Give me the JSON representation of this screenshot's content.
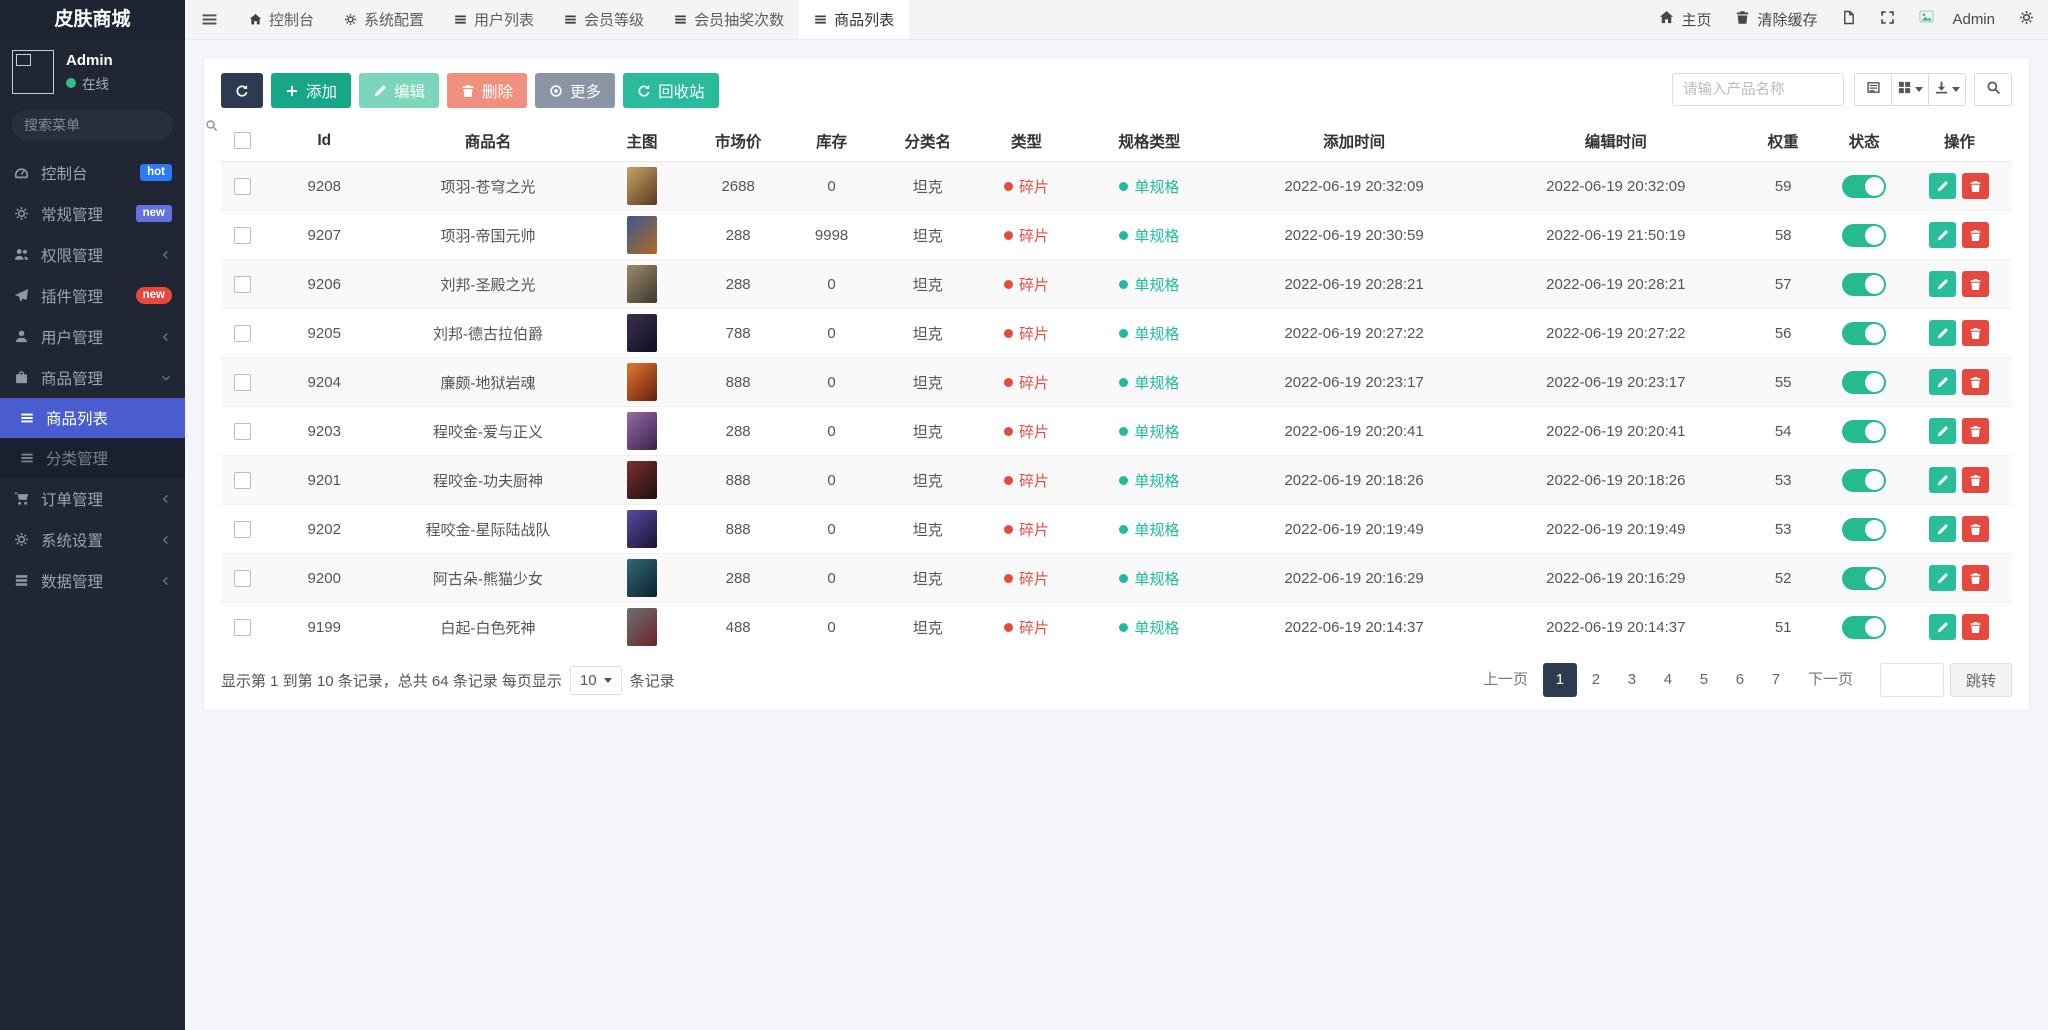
{
  "colors": {
    "sidebar_active": "#4a5dd0",
    "online": "#2fbe8f",
    "type_red": "#e8493e",
    "spec_green": "#1fbc9c",
    "toggle_on": "#25ba90",
    "edit_green": "#2abd9a",
    "delete_red": "#e5493d",
    "page_active": "#2e3a4d"
  },
  "brand": {
    "title": "皮肤商城"
  },
  "user_panel": {
    "name": "Admin",
    "status_label": "在线"
  },
  "sidebar": {
    "search_placeholder": "搜索菜单",
    "menu": [
      {
        "label": "控制台",
        "icon": "dashboard-icon",
        "badge": "hot",
        "badge_color": "#2d7bf4"
      },
      {
        "label": "常规管理",
        "icon": "gear-icon",
        "badge": "new",
        "badge_color": "#6372e0"
      },
      {
        "label": "权限管理",
        "icon": "users-icon",
        "chevron": "left"
      },
      {
        "label": "插件管理",
        "icon": "send-icon",
        "badge": "new",
        "badge_color": "#e8473c",
        "badge_pill": true
      },
      {
        "label": "用户管理",
        "icon": "user-icon",
        "chevron": "left"
      },
      {
        "label": "商品管理",
        "icon": "bag-icon",
        "chevron": "down",
        "expanded": true,
        "children": [
          {
            "label": "商品列表",
            "icon": "list-icon",
            "active": true
          },
          {
            "label": "分类管理",
            "icon": "list-icon"
          }
        ]
      },
      {
        "label": "订单管理",
        "icon": "cart-icon",
        "chevron": "left"
      },
      {
        "label": "系统设置",
        "icon": "gear-icon",
        "chevron": "left"
      },
      {
        "label": "数据管理",
        "icon": "database-icon",
        "chevron": "left"
      }
    ]
  },
  "navbar": {
    "tabs": [
      {
        "label": "控制台",
        "icon": "home-icon"
      },
      {
        "label": "系统配置",
        "icon": "gear-icon"
      },
      {
        "label": "用户列表",
        "icon": "list-icon"
      },
      {
        "label": "会员等级",
        "icon": "list-icon"
      },
      {
        "label": "会员抽奖次数",
        "icon": "list-icon"
      },
      {
        "label": "商品列表",
        "icon": "list-icon",
        "active": true
      }
    ],
    "right": {
      "home_label": "主页",
      "clear_cache_label": "清除缓存",
      "username": "Admin"
    }
  },
  "toolbar": {
    "buttons": [
      {
        "name": "refresh-button",
        "icon": "refresh-icon",
        "label": "",
        "color": "#2e3a4f"
      },
      {
        "name": "add-button",
        "icon": "plus-icon",
        "label": "添加",
        "color": "#18a689"
      },
      {
        "name": "edit-button",
        "icon": "pencil-icon",
        "label": "编辑",
        "color": "#7bd6bb",
        "disabled": true
      },
      {
        "name": "delete-button",
        "icon": "trash-icon",
        "label": "删除",
        "color": "#f0917f",
        "disabled": true
      },
      {
        "name": "more-button",
        "icon": "circle-dot-icon",
        "label": "更多",
        "color": "#8b95a5"
      },
      {
        "name": "recycle-bin-button",
        "icon": "recycle-icon",
        "label": "回收站",
        "color": "#29bb9c"
      }
    ],
    "search_placeholder": "请输入产品名称"
  },
  "table": {
    "columns": [
      "Id",
      "商品名",
      "主图",
      "市场价",
      "库存",
      "分类名",
      "类型",
      "规格类型",
      "添加时间",
      "编辑时间",
      "权重",
      "状态",
      "操作"
    ],
    "rows": [
      {
        "id": "9208",
        "name": "项羽-苍穹之光",
        "price": "2688",
        "stock": "0",
        "category": "坦克",
        "type": "碎片",
        "spec": "单规格",
        "created": "2022-06-19 20:32:09",
        "updated": "2022-06-19 20:32:09",
        "weight": "59",
        "status": true,
        "thumb": [
          "#c9a36a",
          "#59381e"
        ]
      },
      {
        "id": "9207",
        "name": "项羽-帝国元帅",
        "price": "288",
        "stock": "9998",
        "category": "坦克",
        "type": "碎片",
        "spec": "单规格",
        "created": "2022-06-19 20:30:59",
        "updated": "2022-06-19 21:50:19",
        "weight": "58",
        "status": true,
        "thumb": [
          "#3a5a8c",
          "#b06a28"
        ]
      },
      {
        "id": "9206",
        "name": "刘邦-圣殿之光",
        "price": "288",
        "stock": "0",
        "category": "坦克",
        "type": "碎片",
        "spec": "单规格",
        "created": "2022-06-19 20:28:21",
        "updated": "2022-06-19 20:28:21",
        "weight": "57",
        "status": true,
        "thumb": [
          "#9a8a68",
          "#3f3a30"
        ]
      },
      {
        "id": "9205",
        "name": "刘邦-德古拉伯爵",
        "price": "788",
        "stock": "0",
        "category": "坦克",
        "type": "碎片",
        "spec": "单规格",
        "created": "2022-06-19 20:27:22",
        "updated": "2022-06-19 20:27:22",
        "weight": "56",
        "status": true,
        "thumb": [
          "#3a3050",
          "#120e20"
        ]
      },
      {
        "id": "9204",
        "name": "廉颇-地狱岩魂",
        "price": "888",
        "stock": "0",
        "category": "坦克",
        "type": "碎片",
        "spec": "单规格",
        "created": "2022-06-19 20:23:17",
        "updated": "2022-06-19 20:23:17",
        "weight": "55",
        "status": true,
        "thumb": [
          "#e07830",
          "#66200e"
        ]
      },
      {
        "id": "9203",
        "name": "程咬金-爱与正义",
        "price": "288",
        "stock": "0",
        "category": "坦克",
        "type": "碎片",
        "spec": "单规格",
        "created": "2022-06-19 20:20:41",
        "updated": "2022-06-19 20:20:41",
        "weight": "54",
        "status": true,
        "thumb": [
          "#9a6aa8",
          "#35244e"
        ]
      },
      {
        "id": "9201",
        "name": "程咬金-功夫厨神",
        "price": "888",
        "stock": "0",
        "category": "坦克",
        "type": "碎片",
        "spec": "单规格",
        "created": "2022-06-19 20:18:26",
        "updated": "2022-06-19 20:18:26",
        "weight": "53",
        "status": true,
        "thumb": [
          "#7a3030",
          "#1e1010"
        ]
      },
      {
        "id": "9202",
        "name": "程咬金-星际陆战队",
        "price": "888",
        "stock": "0",
        "category": "坦克",
        "type": "碎片",
        "spec": "单规格",
        "created": "2022-06-19 20:19:49",
        "updated": "2022-06-19 20:19:49",
        "weight": "53",
        "status": true,
        "thumb": [
          "#5a4aa0",
          "#191432"
        ]
      },
      {
        "id": "9200",
        "name": "阿古朵-熊猫少女",
        "price": "288",
        "stock": "0",
        "category": "坦克",
        "type": "碎片",
        "spec": "单规格",
        "created": "2022-06-19 20:16:29",
        "updated": "2022-06-19 20:16:29",
        "weight": "52",
        "status": true,
        "thumb": [
          "#2e6a78",
          "#14202e"
        ]
      },
      {
        "id": "9199",
        "name": "白起-白色死神",
        "price": "488",
        "stock": "0",
        "category": "坦克",
        "type": "碎片",
        "spec": "单规格",
        "created": "2022-06-19 20:14:37",
        "updated": "2022-06-19 20:14:37",
        "weight": "51",
        "status": true,
        "thumb": [
          "#6a7078",
          "#6e2626"
        ]
      }
    ]
  },
  "table_footer": {
    "summary_prefix": "显示第 1 到第 10 条记录，总共 64 条记录 每页显示",
    "page_size": "10",
    "summary_suffix": "条记录",
    "pagination": {
      "prev_label": "上一页",
      "pages": [
        "1",
        "2",
        "3",
        "4",
        "5",
        "6",
        "7"
      ],
      "active_page": "1",
      "next_label": "下一页",
      "jump_label": "跳转",
      "jump_value": ""
    }
  }
}
